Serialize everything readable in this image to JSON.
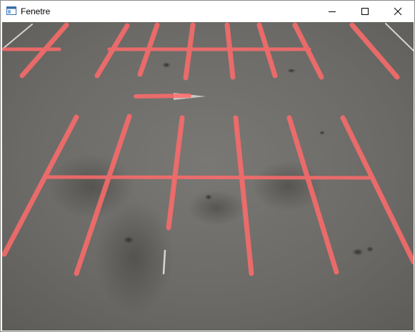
{
  "window": {
    "title": "Fenetre",
    "controls": {
      "minimize_icon": "minimize-icon",
      "maximize_icon": "maximize-icon",
      "close_icon": "close-icon"
    }
  },
  "scene": {
    "description_icon": "parking-lot-image",
    "asphalt_color": "#6d6c68",
    "highlight_color": "#ff6b6b",
    "painted_line_color": "#e9e9e6"
  }
}
